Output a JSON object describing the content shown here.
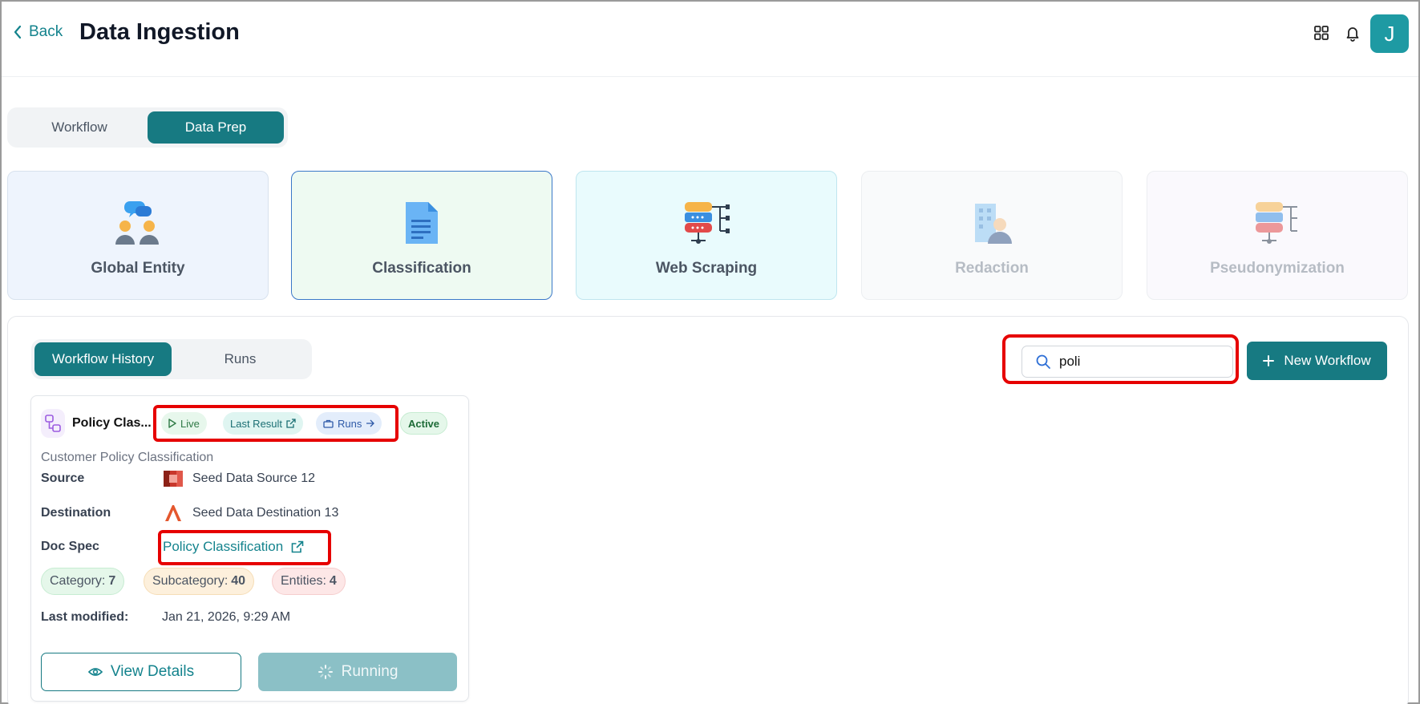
{
  "header": {
    "back_label": "Back",
    "title": "Data Ingestion",
    "avatar_initial": "J"
  },
  "main_tabs": [
    {
      "label": "Workflow",
      "active": false
    },
    {
      "label": "Data Prep",
      "active": true
    }
  ],
  "categories": [
    {
      "label": "Global Entity",
      "icon": "people-chat-icon",
      "bg": "#eef4fd",
      "faded": false,
      "selected": false
    },
    {
      "label": "Classification",
      "icon": "document-icon",
      "bg": "#eefaf2",
      "faded": false,
      "selected": true
    },
    {
      "label": "Web Scraping",
      "icon": "database-network-icon",
      "bg": "#e9fbfd",
      "faded": false,
      "selected": false
    },
    {
      "label": "Redaction",
      "icon": "person-building-icon",
      "bg": "#f9fafb",
      "faded": true,
      "selected": false
    },
    {
      "label": "Pseudonymization",
      "icon": "database-network-icon",
      "bg": "#faf9fd",
      "faded": true,
      "selected": false
    }
  ],
  "sub_tabs": [
    {
      "label": "Workflow History",
      "active": true
    },
    {
      "label": "Runs",
      "active": false
    }
  ],
  "search": {
    "value": "poli",
    "placeholder": ""
  },
  "new_workflow_label": "New Workflow",
  "workflow_card": {
    "name": "Policy Clas...",
    "pills": {
      "live": "Live",
      "last_result": "Last Result",
      "runs": "Runs"
    },
    "status": "Active",
    "description": "Customer Policy Classification",
    "source_label": "Source",
    "source_value": "Seed Data Source 12",
    "destination_label": "Destination",
    "destination_value": "Seed Data Destination 13",
    "docspec_label": "Doc Spec",
    "docspec_value": "Policy Classification",
    "badges": {
      "category_label": "Category:",
      "category_value": "7",
      "subcategory_label": "Subcategory:",
      "subcategory_value": "40",
      "entities_label": "Entities:",
      "entities_value": "4"
    },
    "last_modified_label": "Last modified:",
    "last_modified_value": "Jan 21, 2026, 9:29 AM",
    "view_details_label": "View Details",
    "running_label": "Running"
  },
  "colors": {
    "accent": "#177a82",
    "highlight": "#e60000"
  }
}
